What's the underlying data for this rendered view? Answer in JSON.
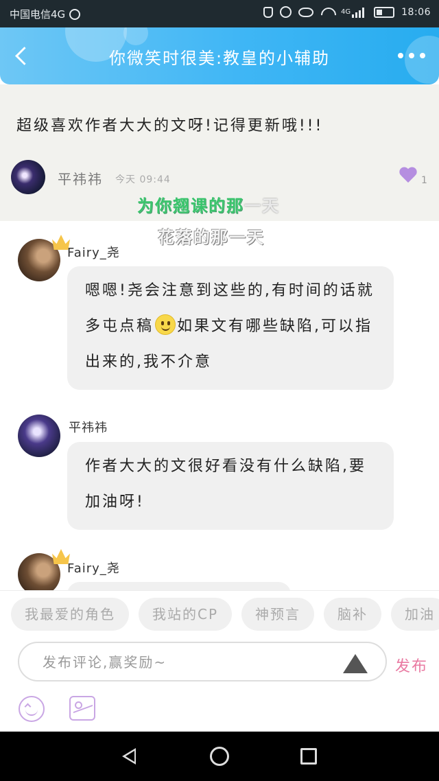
{
  "status_bar": {
    "carrier": "中国电信4G",
    "net_badge": "4G",
    "time": "18:06",
    "icons": [
      "globe-icon",
      "mute-icon",
      "alarm-icon",
      "eye-icon",
      "wifi-icon",
      "signal-icon",
      "battery-icon"
    ]
  },
  "header": {
    "title": "你微笑时很美:教皇的小辅助",
    "icons": [
      "back-icon",
      "more-icon"
    ]
  },
  "top_comment": {
    "text": "超级喜欢作者大大的文呀!记得更新哦!!!",
    "author": "平祎祎",
    "time": "今天 09:44",
    "likes": "1"
  },
  "overlay": {
    "line1_green": "为你翘课的那",
    "line1_pale": "一天",
    "line2": "花落的那一天"
  },
  "replies": [
    {
      "author": "Fairy_尧",
      "text_a": "嗯嗯!尧会注意到这些的,有时间的话就多屯点稿",
      "text_b": "如果文有哪些缺陷,可以指出来的,我不介意"
    },
    {
      "author": "平祎祎",
      "text": "作者大大的文很好看没有什么缺陷,要加油呀!"
    },
    {
      "author": "Fairy_尧"
    }
  ],
  "chips": [
    "我最爱的角色",
    "我站的CP",
    "神预言",
    "脑补",
    "加油"
  ],
  "composer": {
    "placeholder": "发布评论,赢奖励~",
    "submit_label": "发布"
  },
  "colors": {
    "header_gradient_start": "#6ec7f5",
    "header_gradient_end": "#27acef",
    "accent_pink": "#e97aa2",
    "heart": "#b58ee0"
  }
}
